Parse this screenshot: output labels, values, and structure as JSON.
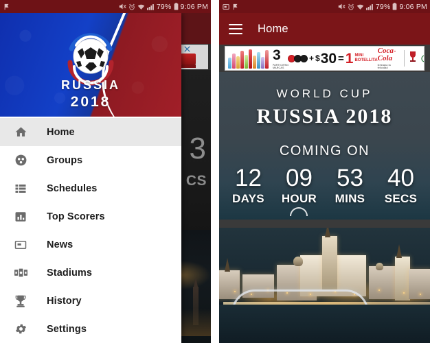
{
  "status_bar": {
    "left_icons": [
      "screenshot-icon",
      "flag-icon"
    ],
    "right_icons": [
      "mute-icon",
      "alarm-icon",
      "wifi-icon",
      "signal-icon",
      "battery-icon"
    ],
    "battery_percent": "79%",
    "time": "9:06 PM"
  },
  "left_screen": {
    "drawer": {
      "header": {
        "logo": "russia-2018-world-cup-logo",
        "title": "RUSSIA",
        "year": "2018"
      },
      "items": [
        {
          "label": "Home",
          "icon": "home-icon",
          "active": true
        },
        {
          "label": "Groups",
          "icon": "groups-icon",
          "active": false
        },
        {
          "label": "Schedules",
          "icon": "list-icon",
          "active": false
        },
        {
          "label": "Top Scorers",
          "icon": "bar-chart-icon",
          "active": false
        },
        {
          "label": "News",
          "icon": "news-icon",
          "active": false
        },
        {
          "label": "Stadiums",
          "icon": "stadium-icon",
          "active": false
        },
        {
          "label": "History",
          "icon": "trophy-icon",
          "active": false
        },
        {
          "label": "Settings",
          "icon": "gear-icon",
          "active": false
        }
      ]
    },
    "scrim": {
      "partial_number": "3",
      "partial_label": "CS"
    }
  },
  "right_screen": {
    "appbar": {
      "menu_icon": "hamburger-icon",
      "title": "Home"
    },
    "ad": {
      "offer_count": "3",
      "plus": "+",
      "currency": "$",
      "price": "30",
      "equals": "=",
      "result": "1",
      "result_label": "MINI BOTELLITA",
      "fine_print": "PARTICIPAN MARCAS",
      "brand": "Coca-Cola",
      "brand_sub": "Destapa la felicidad",
      "adchoices_icon": "adchoices-info-icon",
      "close_icon": "close-icon"
    },
    "hero": {
      "subtitle": "WORLD CUP",
      "title": "RUSSIA 2018",
      "coming_label": "COMING ON",
      "countdown": [
        {
          "value": "12",
          "unit": "DAYS"
        },
        {
          "value": "09",
          "unit": "HOUR"
        },
        {
          "value": "53",
          "unit": "MINS"
        },
        {
          "value": "40",
          "unit": "SECS"
        }
      ],
      "background_image": "moscow-kremlin-night-photo"
    }
  },
  "colors": {
    "appbar_red": "#7b1518",
    "statusbar_red": "#6e1216",
    "drawer_blue": "#1340c7",
    "drawer_red": "#a11f28",
    "active_item_bg": "#e8e8e8"
  }
}
